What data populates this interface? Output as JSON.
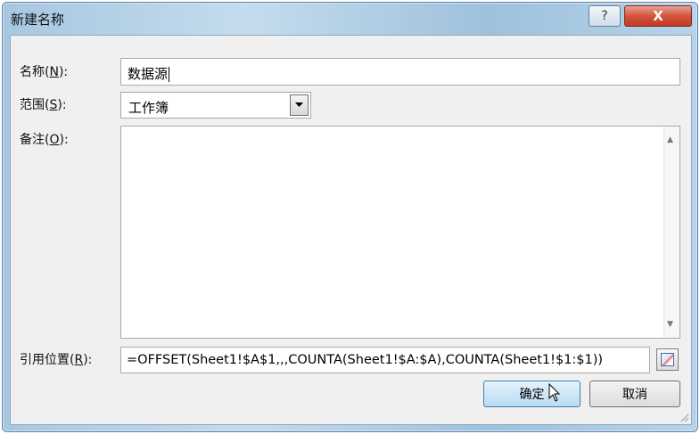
{
  "window": {
    "title": "新建名称",
    "help_label": "?",
    "close_label": "X"
  },
  "fields": {
    "name": {
      "label_prefix": "名称(",
      "label_key": "N",
      "label_suffix": "):",
      "value": "数据源"
    },
    "scope": {
      "label_prefix": "范围(",
      "label_key": "S",
      "label_suffix": "):",
      "value": "工作簿"
    },
    "comment": {
      "label_prefix": "备注(",
      "label_key": "O",
      "label_suffix": "):",
      "value": ""
    },
    "refers_to": {
      "label_prefix": "引用位置(",
      "label_key": "R",
      "label_suffix": "):",
      "value": "=OFFSET(Sheet1!$A$1,,,COUNTA(Sheet1!$A:$A),COUNTA(Sheet1!$1:$1))"
    }
  },
  "buttons": {
    "ok": "确定",
    "cancel": "取消"
  },
  "icons": {
    "close": "close-icon",
    "help": "help-icon",
    "dropdown": "chevron-down-icon",
    "collapse": "collapse-dialog-icon",
    "cursor": "mouse-pointer-icon"
  },
  "colors": {
    "title_gradient": "#b6d3ea",
    "close_red": "#c23a24",
    "ok_highlight": "#b9dbf4"
  }
}
